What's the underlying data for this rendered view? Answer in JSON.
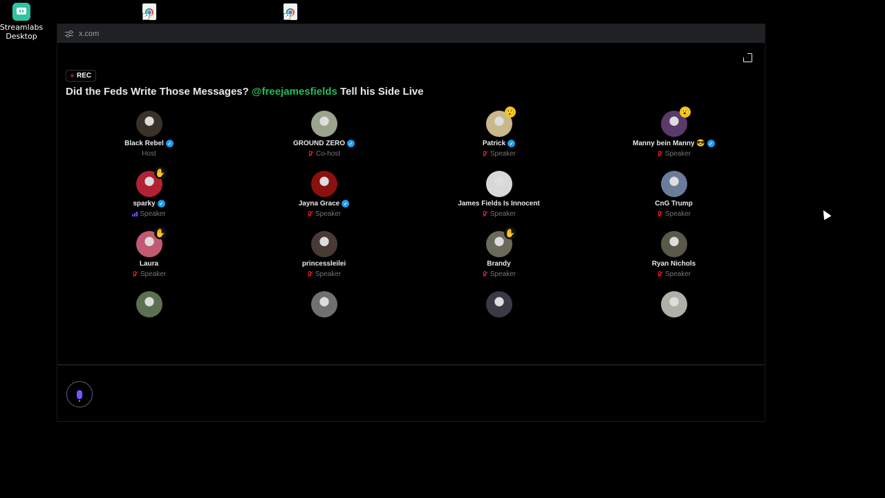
{
  "desktop": {
    "streamlabs_label_line1": "Streamlabs",
    "streamlabs_label_line2": "Desktop"
  },
  "browser": {
    "url": "x.com"
  },
  "space": {
    "rec_label": "REC",
    "title_before": "Did the Feds Write Those Messages? ",
    "title_mention": "@freejamesfields",
    "title_after": " Tell his Side Live",
    "mention_color": "#1ebc5b",
    "participants": [
      {
        "name": "Black Rebel",
        "role": "Host",
        "verified": true,
        "status": "none",
        "avatar_color": "#3a3228"
      },
      {
        "name": "GROUND ZERO",
        "role": "Co-host",
        "verified": true,
        "status": "muted",
        "avatar_color": "#9aa38c"
      },
      {
        "name": "Patrick",
        "role": "Speaker",
        "verified": true,
        "status": "muted",
        "avatar_color": "#c8b88a",
        "badge": "😲"
      },
      {
        "name": "Manny bein Manny 😎",
        "role": "Speaker",
        "verified": true,
        "status": "muted",
        "avatar_color": "#5a3a6a",
        "badge": "😮"
      },
      {
        "name": "sparky",
        "role": "Speaker",
        "verified": true,
        "status": "speaking",
        "avatar_color": "#b22234",
        "raise": true
      },
      {
        "name": "Jayna Grace",
        "role": "Speaker",
        "verified": true,
        "status": "muted",
        "avatar_color": "#8b1010"
      },
      {
        "name": "James Fields Is Innocent",
        "role": "Speaker",
        "verified": false,
        "status": "muted",
        "avatar_color": "#d8d8d8"
      },
      {
        "name": "CnG Trump",
        "role": "Speaker",
        "verified": false,
        "status": "muted",
        "avatar_color": "#6a7c9a"
      },
      {
        "name": "Laura",
        "role": "Speaker",
        "verified": false,
        "status": "muted",
        "avatar_color": "#c25a72",
        "raise": true
      },
      {
        "name": "princessleilei",
        "role": "Speaker",
        "verified": false,
        "status": "muted",
        "avatar_color": "#4a3a36"
      },
      {
        "name": "Brandy",
        "role": "Speaker",
        "verified": false,
        "status": "muted",
        "avatar_color": "#6a6a5a",
        "raise": true
      },
      {
        "name": "Ryan Nichols",
        "role": "Speaker",
        "verified": false,
        "status": "muted",
        "avatar_color": "#5a5a4a"
      },
      {
        "name": "",
        "role": "",
        "verified": false,
        "status": "none",
        "avatar_color": "#5a7050"
      },
      {
        "name": "",
        "role": "",
        "verified": false,
        "status": "none",
        "avatar_color": "#707070"
      },
      {
        "name": "",
        "role": "",
        "verified": false,
        "status": "none",
        "avatar_color": "#3a3a44"
      },
      {
        "name": "",
        "role": "",
        "verified": false,
        "status": "none",
        "avatar_color": "#b0b0a8"
      }
    ]
  },
  "icons": {
    "expand": "expand-icon",
    "mic": "microphone-icon",
    "raise_hand": "raised-hand-icon"
  },
  "colors": {
    "verified": "#1d9bf0",
    "muted": "#f4212e",
    "speaking": "#7856ff",
    "raise_hand": "#f5c518"
  }
}
